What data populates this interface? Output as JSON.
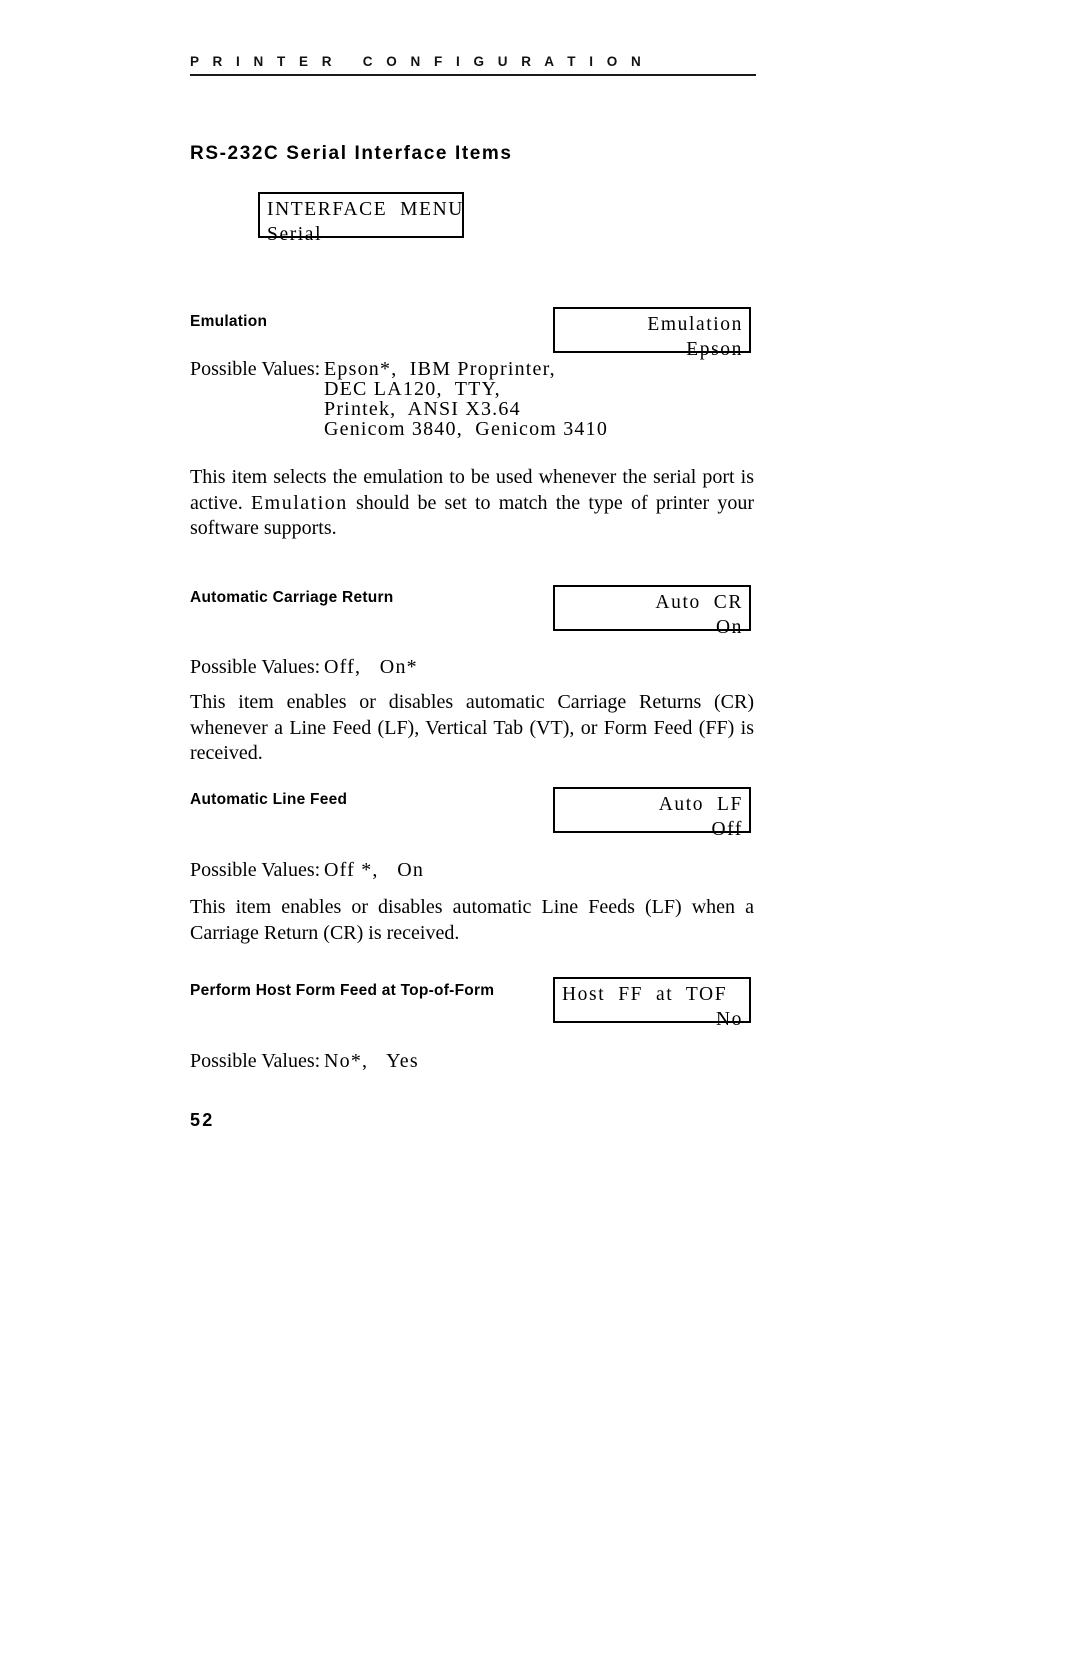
{
  "running_head": {
    "text": "P R I N T E R   C O N F I G U R A T I O N"
  },
  "section": {
    "title": "RS-232C Serial Interface Items"
  },
  "menu_display": {
    "line1": "INTERFACE  MENU",
    "line2": "Serial"
  },
  "items": [
    {
      "heading": "Emulation",
      "display": {
        "line1": "Emulation",
        "line2": "Epson"
      },
      "possible_label": "Possible Values:",
      "possible_values_line1": "Epson*,  IBM Proprinter,",
      "possible_values_line2": "DEC LA120,  TTY,",
      "possible_values_line3": "Printek,  ANSI X3.64",
      "possible_values_line4": "Genicom 3840,  Genicom 3410",
      "description_part1": "This item selects the emulation to be used whenever the serial port is active. ",
      "description_emphasis": "Emulation",
      "description_part2": " should be set to match the type of printer your software supports."
    },
    {
      "heading": "Automatic Carriage Return",
      "display": {
        "line1": "Auto  CR",
        "line2": "On"
      },
      "possible_label": "Possible Values:",
      "possible_values_line1": "Off,   On*",
      "description": "This item enables or disables automatic Carriage Returns (CR) whenever a Line Feed (LF), Vertical Tab (VT), or Form Feed (FF) is received."
    },
    {
      "heading": "Automatic Line Feed",
      "display": {
        "line1": "Auto  LF",
        "line2": "Off"
      },
      "possible_label": "Possible Values:",
      "possible_values_line1": "Off *,   On",
      "description": "This item enables or disables automatic Line Feeds (LF) when a Carriage Return (CR) is received."
    },
    {
      "heading": "Perform Host Form Feed at Top-of-Form",
      "display": {
        "line1": "Host  FF  at  TOF",
        "line2": "No"
      },
      "possible_label": "Possible Values:",
      "possible_values_line1": "No*,   Yes"
    }
  ],
  "page_number": "52"
}
